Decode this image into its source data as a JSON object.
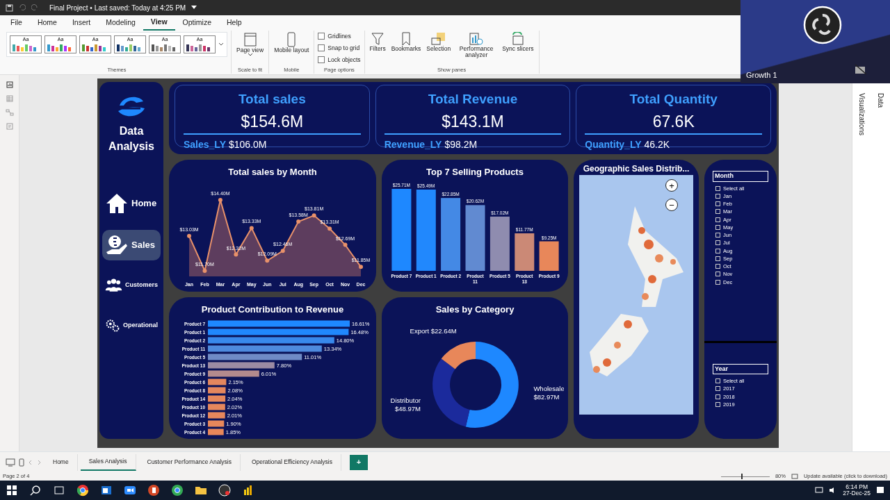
{
  "title_bar": {
    "title": "Final Project • Last saved: Today at 4:25 PM"
  },
  "menu": [
    {
      "label": "File",
      "selected": false
    },
    {
      "label": "Home",
      "selected": false
    },
    {
      "label": "Insert",
      "selected": false
    },
    {
      "label": "Modeling",
      "selected": false
    },
    {
      "label": "View",
      "selected": true
    },
    {
      "label": "Optimize",
      "selected": false
    },
    {
      "label": "Help",
      "selected": false
    }
  ],
  "ribbon": {
    "themes": {
      "swatches": [
        "Aa",
        "Aa",
        "Aa",
        "Aa",
        "Aa",
        "Aa"
      ],
      "label": "Themes"
    },
    "groups": [
      {
        "label": "Scale to fit",
        "items": [
          {
            "kind": "button",
            "text": "Page view",
            "dropdown": true
          }
        ]
      },
      {
        "label": "Mobile",
        "items": [
          {
            "kind": "button",
            "text": "Mobile layout"
          }
        ]
      },
      {
        "label": "Page options",
        "items": [
          {
            "kind": "checkbox",
            "text": "Gridlines",
            "checked": false
          },
          {
            "kind": "checkbox",
            "text": "Snap to grid",
            "checked": false
          },
          {
            "kind": "checkbox",
            "text": "Lock objects",
            "checked": false
          }
        ]
      },
      {
        "label": "Show panes",
        "items": [
          {
            "kind": "button",
            "text": "Filters"
          },
          {
            "kind": "button",
            "text": "Bookmarks"
          },
          {
            "kind": "button",
            "text": "Selection"
          },
          {
            "kind": "button",
            "text": "Performance analyzer"
          },
          {
            "kind": "button",
            "text": "Sync slicers"
          }
        ]
      }
    ]
  },
  "view_rail": [
    {
      "selected": true
    },
    {
      "selected": false
    },
    {
      "selected": false
    },
    {
      "selected": false
    }
  ],
  "report": {
    "nav": {
      "logo_text": "Data Analysis",
      "items": [
        {
          "label": "Home",
          "selected": false
        },
        {
          "label": "Sales",
          "selected": true
        },
        {
          "label": "Customers",
          "selected": false
        },
        {
          "label": "Operational",
          "selected": false
        }
      ]
    },
    "kpis": [
      {
        "title": "Total sales",
        "value": "$154.6M",
        "ly_label": "Sales_LY",
        "ly_value": "$106.0M"
      },
      {
        "title": "Total Revenue",
        "value": "$143.1M",
        "ly_label": "Revenue_LY",
        "ly_value": "$98.2M"
      },
      {
        "title": "Total Quantity",
        "value": "67.6K",
        "ly_label": "Quantity_LY",
        "ly_value": "46.2K"
      }
    ],
    "sales_by_month": {
      "chart_data": {
        "type": "area",
        "title": "Total sales by Month",
        "categories": [
          "Jan",
          "Feb",
          "Mar",
          "Apr",
          "May",
          "Jun",
          "Jul",
          "Aug",
          "Sep",
          "Oct",
          "Nov",
          "Dec"
        ],
        "values": [
          13.03,
          11.7,
          14.4,
          12.32,
          13.33,
          12.09,
          12.46,
          13.58,
          13.81,
          13.31,
          12.69,
          11.85
        ],
        "data_labels": true,
        "value_labels": [
          "$13.03M",
          "$11.70M",
          "$14.40M",
          "$12.32M",
          "$13.33M",
          "$12.09M",
          "$12.46M",
          "$13.58M",
          "$13.81M",
          "$13.31M",
          "$12.69M",
          "$11.85M"
        ]
      }
    },
    "top_products": {
      "chart_data": {
        "type": "bar",
        "title": "Top 7 Selling Products",
        "categories": [
          "Product 7",
          "Product 1",
          "Product 2",
          "Product 11",
          "Product 5",
          "Product 13",
          "Product 9"
        ],
        "values": [
          25.71,
          25.49,
          22.85,
          20.62,
          17.02,
          11.77,
          9.25
        ],
        "data_labels": true,
        "value_labels": [
          "$25.71M",
          "$25.49M",
          "$22.85M",
          "$20.62M",
          "$17.02M",
          "$11.77M",
          "$9.25M"
        ]
      }
    },
    "contribution": {
      "chart_data": {
        "type": "bar",
        "orientation": "horizontal",
        "title": "Product Contribution to Revenue",
        "categories": [
          "Product 7",
          "Product 1",
          "Product 2",
          "Product 11",
          "Product 5",
          "Product 13",
          "Product 9",
          "Product 6",
          "Product 8",
          "Product 14",
          "Product 10",
          "Product 12",
          "Product 3",
          "Product 4"
        ],
        "values": [
          16.61,
          16.48,
          14.8,
          13.34,
          11.01,
          7.8,
          6.01,
          2.15,
          2.08,
          2.04,
          2.02,
          2.01,
          1.9,
          1.85
        ],
        "data_labels": true,
        "value_labels": [
          "16.61%",
          "16.48%",
          "14.80%",
          "13.34%",
          "11.01%",
          "7.80%",
          "6.01%",
          "2.15%",
          "2.08%",
          "2.04%",
          "2.02%",
          "2.01%",
          "1.90%",
          "1.85%"
        ]
      }
    },
    "by_category": {
      "chart_data": {
        "type": "donut",
        "title": "Sales by Category",
        "categories": [
          "Wholesale",
          "Distributor",
          "Export"
        ],
        "values": [
          82.97,
          48.97,
          22.64
        ],
        "data_labels": true,
        "value_labels": [
          "$82.97M",
          "$48.97M",
          "$22.64M"
        ]
      }
    },
    "map": {
      "title": "Geographic Sales Distrib...",
      "zoom_in": "+",
      "zoom_out": "−"
    },
    "slicers": [
      {
        "title": "Month",
        "options": [
          {
            "label": "Select all",
            "checked": false
          },
          {
            "label": "Jan",
            "checked": false
          },
          {
            "label": "Feb",
            "checked": false
          },
          {
            "label": "Mar",
            "checked": false
          },
          {
            "label": "Apr",
            "checked": false
          },
          {
            "label": "May",
            "checked": false
          },
          {
            "label": "Jun",
            "checked": false
          },
          {
            "label": "Jul",
            "checked": false
          },
          {
            "label": "Aug",
            "checked": false
          },
          {
            "label": "Sep",
            "checked": false
          },
          {
            "label": "Oct",
            "checked": false
          },
          {
            "label": "Nov",
            "checked": false
          },
          {
            "label": "Dec",
            "checked": false
          }
        ]
      },
      {
        "title": "Year",
        "options": [
          {
            "label": "Select all",
            "checked": false
          },
          {
            "label": "2017",
            "checked": false
          },
          {
            "label": "2018",
            "checked": false
          },
          {
            "label": "2019",
            "checked": false
          }
        ]
      }
    ]
  },
  "side_panes": [
    "Visualizations",
    "Data"
  ],
  "overlay": {
    "label": "Growth 1"
  },
  "page_tabs": [
    {
      "label": "Home",
      "selected": false
    },
    {
      "label": "Sales Analysis",
      "selected": true
    },
    {
      "label": "Customer Performance Analysis",
      "selected": false
    },
    {
      "label": "Operational Efficiency Analysis",
      "selected": false
    }
  ],
  "add_page": "+",
  "status_bar": {
    "page": "Page 2 of 4",
    "zoom": "80%",
    "zoom_slider": {
      "level": 0.42
    },
    "update": "Update available (click to download)"
  },
  "taskbar": {
    "time": "6:14 PM",
    "date": "27-Dec-25"
  }
}
